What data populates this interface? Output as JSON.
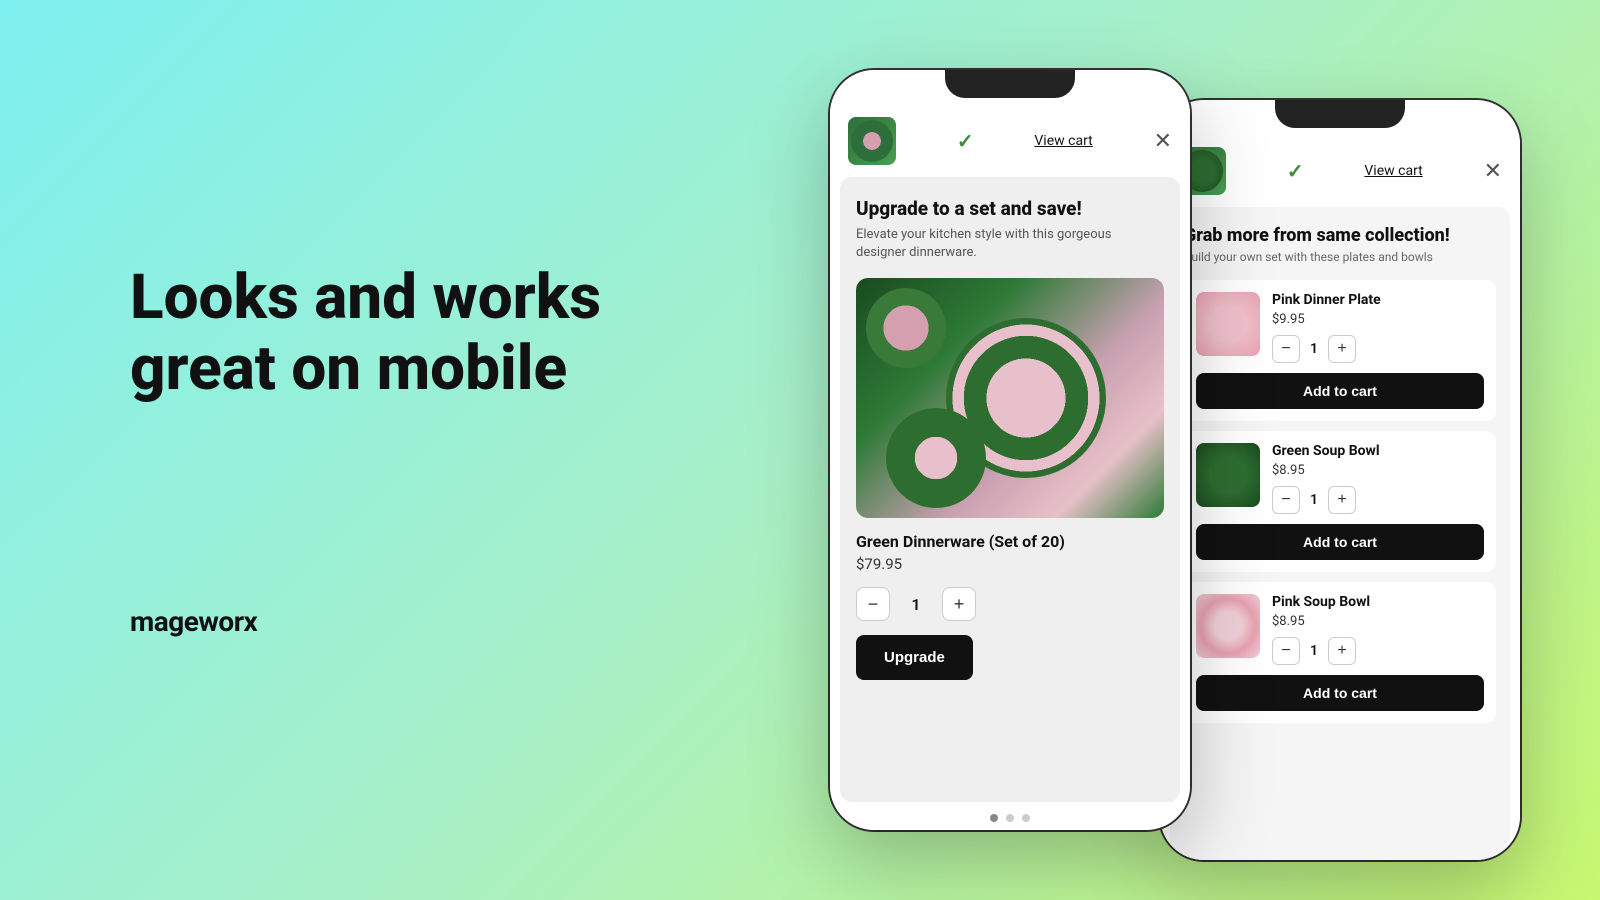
{
  "hero": {
    "title_line1": "Looks and works",
    "title_line2": "great on mobile",
    "brand": "mageworx"
  },
  "phone1": {
    "header": {
      "view_cart": "View cart",
      "close": "✕"
    },
    "body": {
      "upgrade_title": "Upgrade to a set and save!",
      "upgrade_subtitle": "Elevate your kitchen style with this gorgeous designer dinnerware.",
      "product_name": "Green Dinnerware (Set of 20)",
      "product_price": "$79.95",
      "quantity": "1",
      "upgrade_button": "Upgrade"
    },
    "dots": [
      "dot1",
      "dot2",
      "dot3"
    ]
  },
  "phone2": {
    "header": {
      "view_cart": "View cart",
      "close": "✕"
    },
    "body": {
      "title": "Grab more from same collection!",
      "subtitle": "Build your own set with these plates and bowls",
      "products": [
        {
          "name": "Pink Dinner Plate",
          "price": "$9.95",
          "quantity": "1",
          "add_to_cart": "Add to cart"
        },
        {
          "name": "Green Soup Bowl",
          "price": "$8.95",
          "quantity": "1",
          "add_to_cart": "Add to cart"
        },
        {
          "name": "Pink Soup Bowl",
          "price": "$8.95",
          "quantity": "1",
          "add_to_cart": "Add to cart"
        }
      ]
    }
  },
  "icons": {
    "check": "✓",
    "close": "✕",
    "minus": "−",
    "plus": "+"
  }
}
